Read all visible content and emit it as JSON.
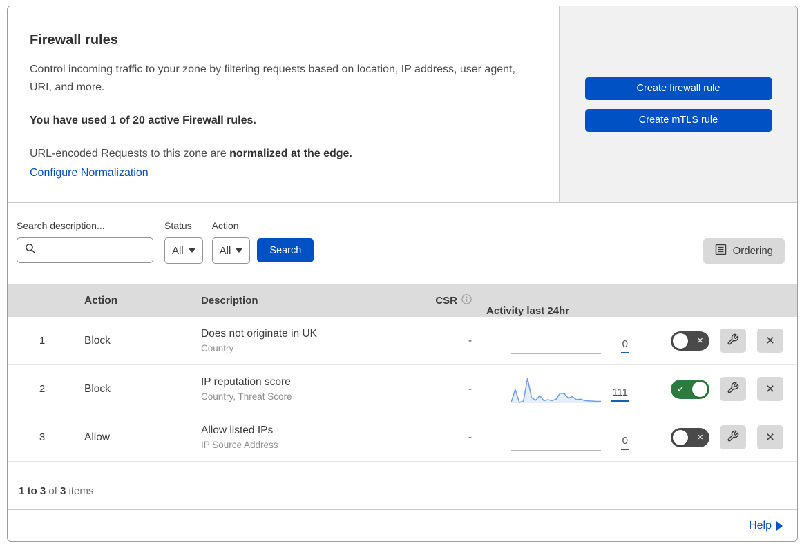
{
  "header": {
    "title": "Firewall rules",
    "description": "Control incoming traffic to your zone by filtering requests based on location, IP address, user agent, URI, and more.",
    "usage_bold": "You have used 1 of 20 active Firewall rules.",
    "normalization_prefix": "URL-encoded Requests to this zone are ",
    "normalization_bold": "normalized at the edge.",
    "normalization_link": "Configure Normalization",
    "buttons": [
      {
        "label": "Create firewall rule"
      },
      {
        "label": "Create mTLS rule"
      }
    ]
  },
  "filters": {
    "search_label": "Search description...",
    "search_value": "",
    "status_label": "Status",
    "status_value": "All",
    "action_label": "Action",
    "action_value": "All",
    "search_button_label": "Search",
    "ordering_button_label": "Ordering"
  },
  "table": {
    "columns": {
      "action": "Action",
      "description": "Description",
      "csr": "CSR",
      "activity": "Activity last 24hr"
    },
    "rows": [
      {
        "index": "1",
        "action": "Block",
        "description": "Does not originate in UK",
        "fields": "Country",
        "csr": "-",
        "activity_count": "0",
        "enabled": false,
        "sparkline": []
      },
      {
        "index": "2",
        "action": "Block",
        "description": "IP reputation score",
        "fields": "Country, Threat Score",
        "csr": "-",
        "activity_count": "111",
        "enabled": true,
        "sparkline": [
          3,
          55,
          3,
          8,
          100,
          22,
          12,
          30,
          10,
          14,
          10,
          16,
          40,
          38,
          20,
          26,
          14,
          16,
          10,
          9,
          8,
          7,
          7
        ]
      },
      {
        "index": "3",
        "action": "Allow",
        "description": "Allow listed IPs",
        "fields": "IP Source Address",
        "csr": "-",
        "activity_count": "0",
        "enabled": false,
        "sparkline": []
      }
    ]
  },
  "footer": {
    "range_bold": "1 to 3",
    "of_text": " of ",
    "total_bold": "3",
    "items_text": " items",
    "help_label": "Help"
  },
  "colors": {
    "primary_blue": "#0051c3",
    "toggle_on_green": "#2c7c3f",
    "toggle_off_gray": "#4a4a4a",
    "sparkline_stroke": "#6d9ee3",
    "sparkline_fill": "rgba(109,158,227,0.18)",
    "header_band_gray": "#dcdcdc",
    "panel_gray": "#f1f1f1",
    "icon_button_gray": "#d9d9d9"
  }
}
